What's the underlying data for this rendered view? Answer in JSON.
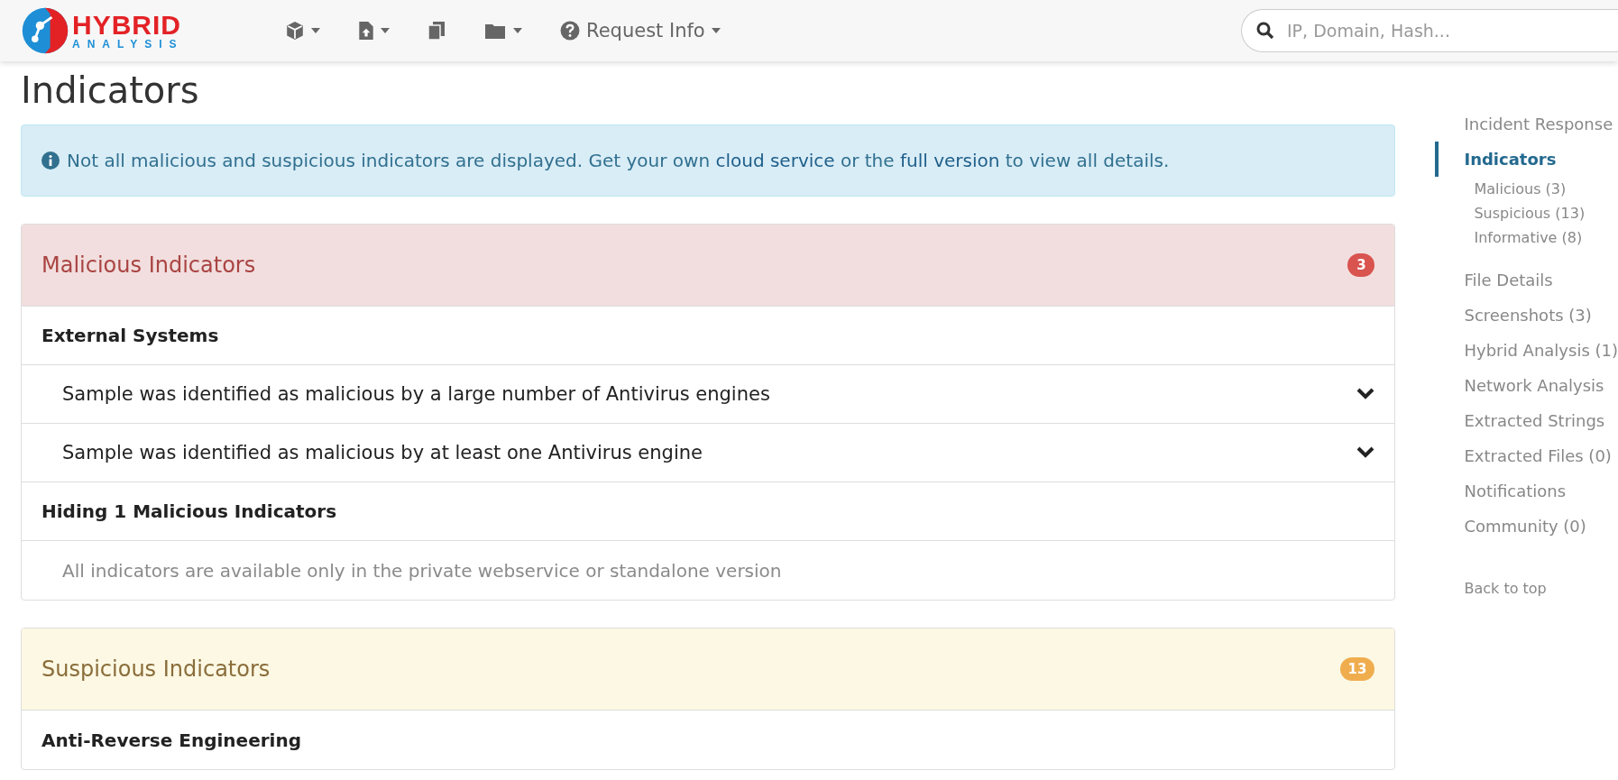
{
  "logo": {
    "line1": "HYBRID",
    "line2": "ANALYSIS"
  },
  "nav": [
    {
      "kind": "cube",
      "dropdown": true
    },
    {
      "kind": "upload",
      "dropdown": true
    },
    {
      "kind": "copy",
      "dropdown": false
    },
    {
      "kind": "folder",
      "dropdown": true
    },
    {
      "kind": "help",
      "label": "Request Info",
      "dropdown": true
    }
  ],
  "search": {
    "placeholder": "IP, Domain, Hash..."
  },
  "page_title": "Indicators",
  "alert": {
    "parts": [
      {
        "kind": "text",
        "text": "Not all malicious and suspicious indicators are displayed. Get your own "
      },
      {
        "kind": "link",
        "text": "cloud service"
      },
      {
        "kind": "text",
        "text": " or the "
      },
      {
        "kind": "link",
        "text": "full version"
      },
      {
        "kind": "text",
        "text": " to view all details."
      }
    ]
  },
  "panels": [
    {
      "kind": "malicious",
      "title": "Malicious Indicators",
      "count": "3",
      "rows": [
        {
          "kind": "category",
          "text": "External Systems"
        },
        {
          "kind": "indicator",
          "text": "Sample was identified as malicious by a large number of Antivirus engines",
          "expanded": false
        },
        {
          "kind": "indicator",
          "text": "Sample was identified as malicious by at least one Antivirus engine",
          "expanded": false
        },
        {
          "kind": "category",
          "text": "Hiding 1 Malicious Indicators"
        },
        {
          "kind": "hidden-note",
          "text": "All indicators are available only in the private webservice or standalone version"
        }
      ]
    },
    {
      "kind": "suspicious",
      "title": "Suspicious Indicators",
      "count": "13",
      "rows": [
        {
          "kind": "category",
          "text": "Anti-Reverse Engineering"
        }
      ]
    }
  ],
  "sidebar": {
    "items": [
      {
        "label": "Incident Response",
        "selected": false
      },
      {
        "label": "Indicators",
        "selected": true,
        "children": [
          {
            "label": "Malicious (3)"
          },
          {
            "label": "Suspicious (13)"
          },
          {
            "label": "Informative (8)"
          }
        ]
      },
      {
        "label": "File Details",
        "selected": false
      },
      {
        "label": "Screenshots (3)",
        "selected": false
      },
      {
        "label": "Hybrid Analysis (1)",
        "selected": false
      },
      {
        "label": "Network Analysis",
        "selected": false
      },
      {
        "label": "Extracted Strings",
        "selected": false
      },
      {
        "label": "Extracted Files (0)",
        "selected": false
      },
      {
        "label": "Notifications",
        "selected": false
      },
      {
        "label": "Community (0)",
        "selected": false
      }
    ],
    "back_link": "Back to top"
  }
}
